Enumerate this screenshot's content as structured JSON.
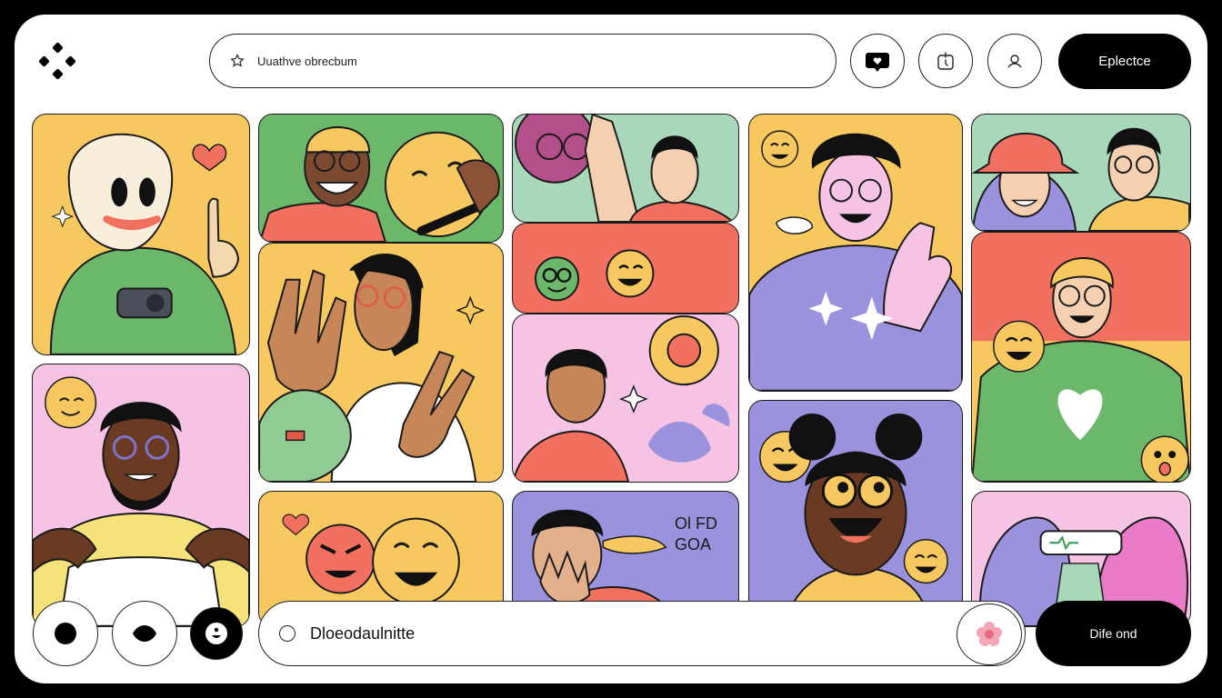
{
  "header": {
    "search": {
      "text": "Uuathve obrecbum",
      "icon": "star-outline-icon"
    },
    "icon_buttons": [
      {
        "name": "heart-chat-icon"
      },
      {
        "name": "timer-box-icon"
      },
      {
        "name": "person-icon"
      }
    ],
    "primary_button": "Eplectce"
  },
  "tiles": {
    "live_label": "Ol FD\nGOA"
  },
  "bottom_bar": {
    "buttons": [
      {
        "name": "record-icon"
      },
      {
        "name": "eye-icon"
      },
      {
        "name": "face-icon"
      }
    ],
    "composer_text": "Dloeodaulnitte",
    "send_button": "Dife ond"
  },
  "colors": {
    "yellow": "#F6C85F",
    "green": "#6BB86A",
    "pink": "#F6C3E4",
    "coral": "#F2705F",
    "purple": "#9B92DE",
    "mint": "#A8D8B9"
  }
}
